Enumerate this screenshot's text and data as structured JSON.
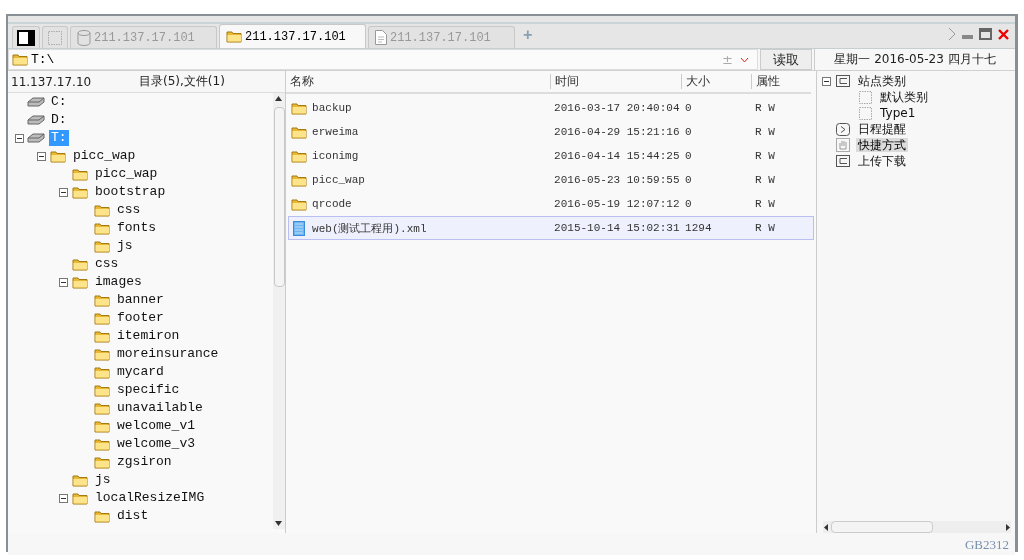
{
  "tabs": [
    {
      "kind": "panel",
      "selected": false
    },
    {
      "kind": "blank",
      "selected": false
    },
    {
      "kind": "database",
      "label": "211.137.17.101",
      "selected": false
    },
    {
      "kind": "folder",
      "label": "211.137.17.101",
      "selected": true
    },
    {
      "kind": "document",
      "label": "211.137.17.101",
      "selected": false
    }
  ],
  "new_tab": "+",
  "address": {
    "value": "T:\\",
    "toggle": "±",
    "read_button": "读取"
  },
  "date_line": "星期一 2016-05-23 四月十七",
  "left_header": {
    "host": "11.137.17.10",
    "summary": "目录(5),文件(1)"
  },
  "tree": [
    {
      "label": "C:",
      "kind": "drive",
      "expanded": false,
      "selected": false
    },
    {
      "label": "D:",
      "kind": "drive",
      "expanded": false,
      "selected": false
    },
    {
      "label": "T:",
      "kind": "drive",
      "expanded": true,
      "selected": true,
      "children": [
        {
          "label": "picc_wap",
          "kind": "folder",
          "expanded": true,
          "selected": false,
          "children": [
            {
              "label": "picc_wap",
              "kind": "folder",
              "expanded": false,
              "selected": false
            },
            {
              "label": "bootstrap",
              "kind": "folder",
              "expanded": true,
              "selected": false,
              "children": [
                {
                  "label": "css",
                  "kind": "folder",
                  "expanded": false,
                  "selected": false
                },
                {
                  "label": "fonts",
                  "kind": "folder",
                  "expanded": false,
                  "selected": false
                },
                {
                  "label": "js",
                  "kind": "folder",
                  "expanded": false,
                  "selected": false
                }
              ]
            },
            {
              "label": "css",
              "kind": "folder",
              "expanded": false,
              "selected": false
            },
            {
              "label": "images",
              "kind": "folder",
              "expanded": true,
              "selected": false,
              "children": [
                {
                  "label": "banner",
                  "kind": "folder",
                  "expanded": false,
                  "selected": false
                },
                {
                  "label": "footer",
                  "kind": "folder",
                  "expanded": false,
                  "selected": false
                },
                {
                  "label": "itemiron",
                  "kind": "folder",
                  "expanded": false,
                  "selected": false
                },
                {
                  "label": "moreinsurance",
                  "kind": "folder",
                  "expanded": false,
                  "selected": false
                },
                {
                  "label": "mycard",
                  "kind": "folder",
                  "expanded": false,
                  "selected": false
                },
                {
                  "label": "specific",
                  "kind": "folder",
                  "expanded": false,
                  "selected": false
                },
                {
                  "label": "unavailable",
                  "kind": "folder",
                  "expanded": false,
                  "selected": false
                },
                {
                  "label": "welcome_v1",
                  "kind": "folder",
                  "expanded": false,
                  "selected": false
                },
                {
                  "label": "welcome_v3",
                  "kind": "folder",
                  "expanded": false,
                  "selected": false
                },
                {
                  "label": "zgsiron",
                  "kind": "folder",
                  "expanded": false,
                  "selected": false
                }
              ]
            },
            {
              "label": "js",
              "kind": "folder",
              "expanded": false,
              "selected": false
            },
            {
              "label": "localResizeIMG",
              "kind": "folder",
              "expanded": true,
              "selected": false,
              "children": [
                {
                  "label": "dist",
                  "kind": "folder",
                  "expanded": false,
                  "selected": false
                }
              ]
            }
          ]
        }
      ]
    }
  ],
  "file_table": {
    "columns": [
      "名称",
      "时间",
      "大小",
      "属性"
    ],
    "rows": [
      {
        "kind": "folder",
        "name": "backup",
        "time": "2016-03-17 20:40:04",
        "size": "0",
        "attributes": "R W",
        "selected": false
      },
      {
        "kind": "folder",
        "name": "erweima",
        "time": "2016-04-29 15:21:16",
        "size": "0",
        "attributes": "R W",
        "selected": false
      },
      {
        "kind": "folder",
        "name": "iconimg",
        "time": "2016-04-14 15:44:25",
        "size": "0",
        "attributes": "R W",
        "selected": false
      },
      {
        "kind": "folder",
        "name": "picc_wap",
        "time": "2016-05-23 10:59:55",
        "size": "0",
        "attributes": "R W",
        "selected": false
      },
      {
        "kind": "folder",
        "name": "qrcode",
        "time": "2016-05-19 12:07:12",
        "size": "0",
        "attributes": "R W",
        "selected": false
      },
      {
        "kind": "file",
        "name": "web(测试工程用).xml",
        "time": "2015-10-14 15:02:31",
        "size": "1294",
        "attributes": "R W",
        "selected": true
      }
    ]
  },
  "side_tree": [
    {
      "label": "站点类别",
      "kind": "category",
      "expanded": true,
      "selected": false,
      "children": [
        {
          "label": "默认类别",
          "kind": "item",
          "expanded": false,
          "selected": false
        },
        {
          "label": "Type1",
          "kind": "item",
          "expanded": false,
          "selected": false
        }
      ]
    },
    {
      "label": "日程提醒",
      "kind": "schedule",
      "expanded": false,
      "selected": false
    },
    {
      "label": "快捷方式",
      "kind": "shortcut",
      "expanded": false,
      "selected": true
    },
    {
      "label": "上传下载",
      "kind": "transfer",
      "expanded": false,
      "selected": false
    }
  ],
  "status_bar": {
    "encoding": "GB2312"
  }
}
